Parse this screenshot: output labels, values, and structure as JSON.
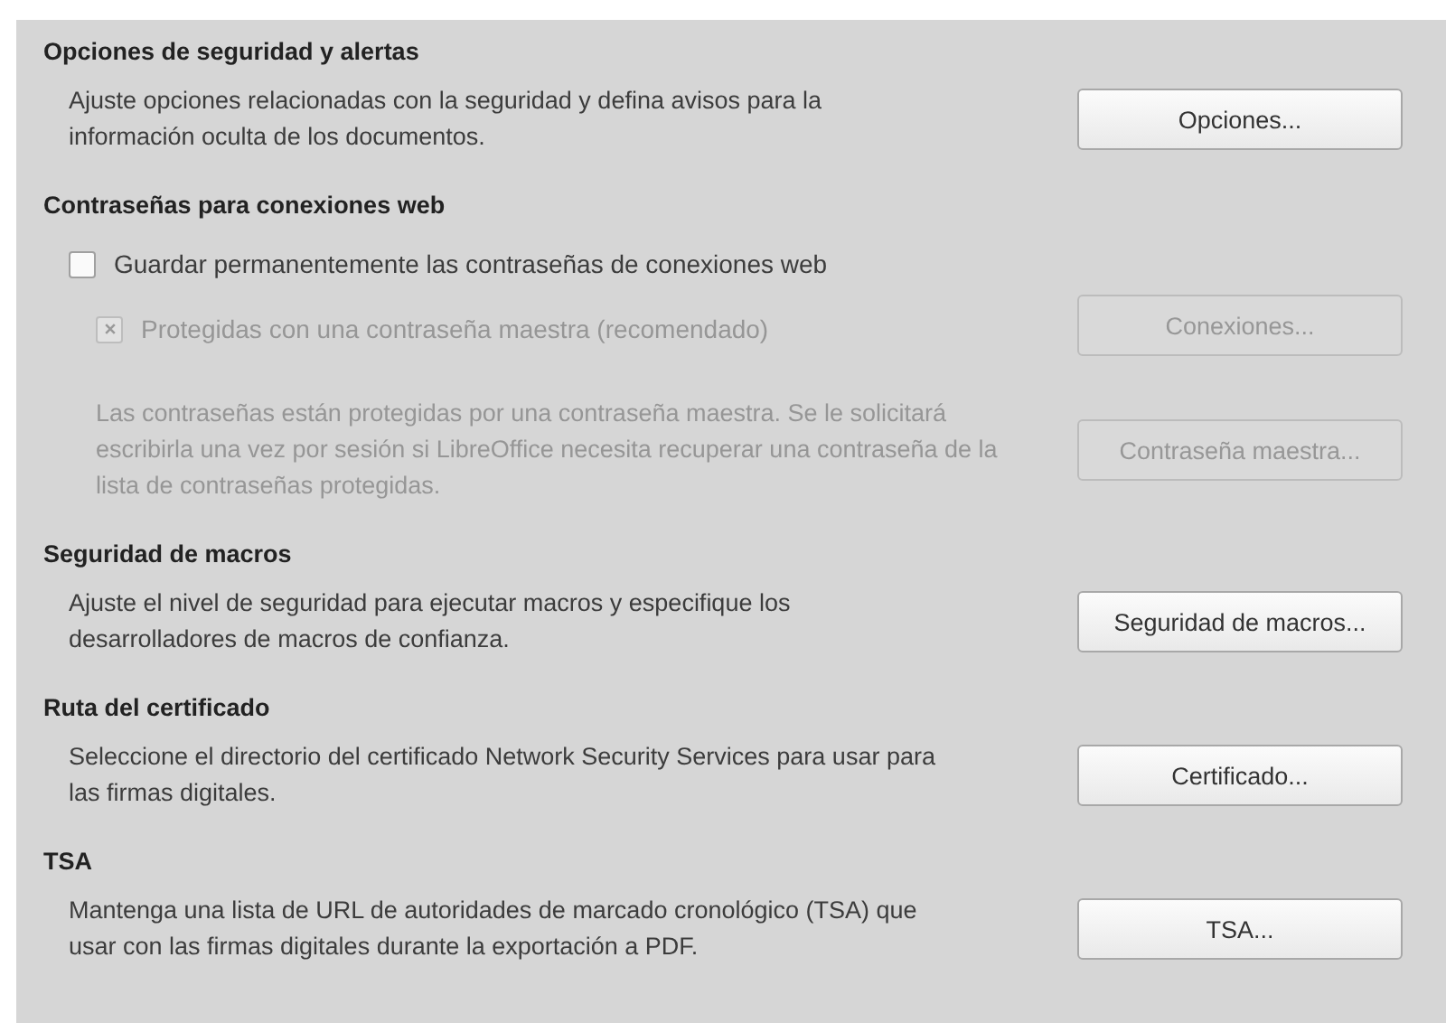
{
  "sections": [
    {
      "title": "Opciones de seguridad y alertas",
      "rows": [
        {
          "kind": "text",
          "text": "Ajuste opciones relacionadas con la seguridad y defina avisos para la información oculta de los documentos.",
          "disabled": false,
          "button": {
            "label": "Opciones...",
            "disabled": false
          }
        }
      ]
    },
    {
      "title": "Contraseñas para conexiones web",
      "rows": [
        {
          "kind": "checkbox",
          "label": "Guardar permanentemente las contraseñas de conexiones web",
          "checked": false,
          "disabled": false,
          "children": [
            {
              "kind": "checkbox",
              "label": "Protegidas con una contraseña maestra (recomendado)",
              "checked": true,
              "disabled": true,
              "button": {
                "label": "Conexiones...",
                "disabled": true
              }
            },
            {
              "kind": "text",
              "text": "Las contraseñas están protegidas por una contraseña maestra. Se le solicitará escribirla una vez por sesión si LibreOffice necesita recuperar una contraseña de la lista de contraseñas protegidas.",
              "disabled": true,
              "button": {
                "label": "Contraseña maestra...",
                "disabled": true
              }
            }
          ]
        }
      ]
    },
    {
      "title": "Seguridad de macros",
      "rows": [
        {
          "kind": "text",
          "text": "Ajuste el nivel de seguridad para ejecutar macros y especifique los desarrolladores de macros de confianza.",
          "disabled": false,
          "button": {
            "label": "Seguridad de macros...",
            "disabled": false
          }
        }
      ]
    },
    {
      "title": "Ruta del certificado",
      "rows": [
        {
          "kind": "text",
          "text": "Seleccione el directorio del certificado Network Security Services para usar para las firmas digitales.",
          "disabled": false,
          "button": {
            "label": "Certificado...",
            "disabled": false
          }
        }
      ]
    },
    {
      "title": "TSA",
      "rows": [
        {
          "kind": "text",
          "text": "Mantenga una lista de URL de autoridades de marcado cronológico (TSA) que usar con las firmas digitales durante la exportación a PDF.",
          "disabled": false,
          "button": {
            "label": "TSA...",
            "disabled": false
          }
        }
      ]
    }
  ]
}
